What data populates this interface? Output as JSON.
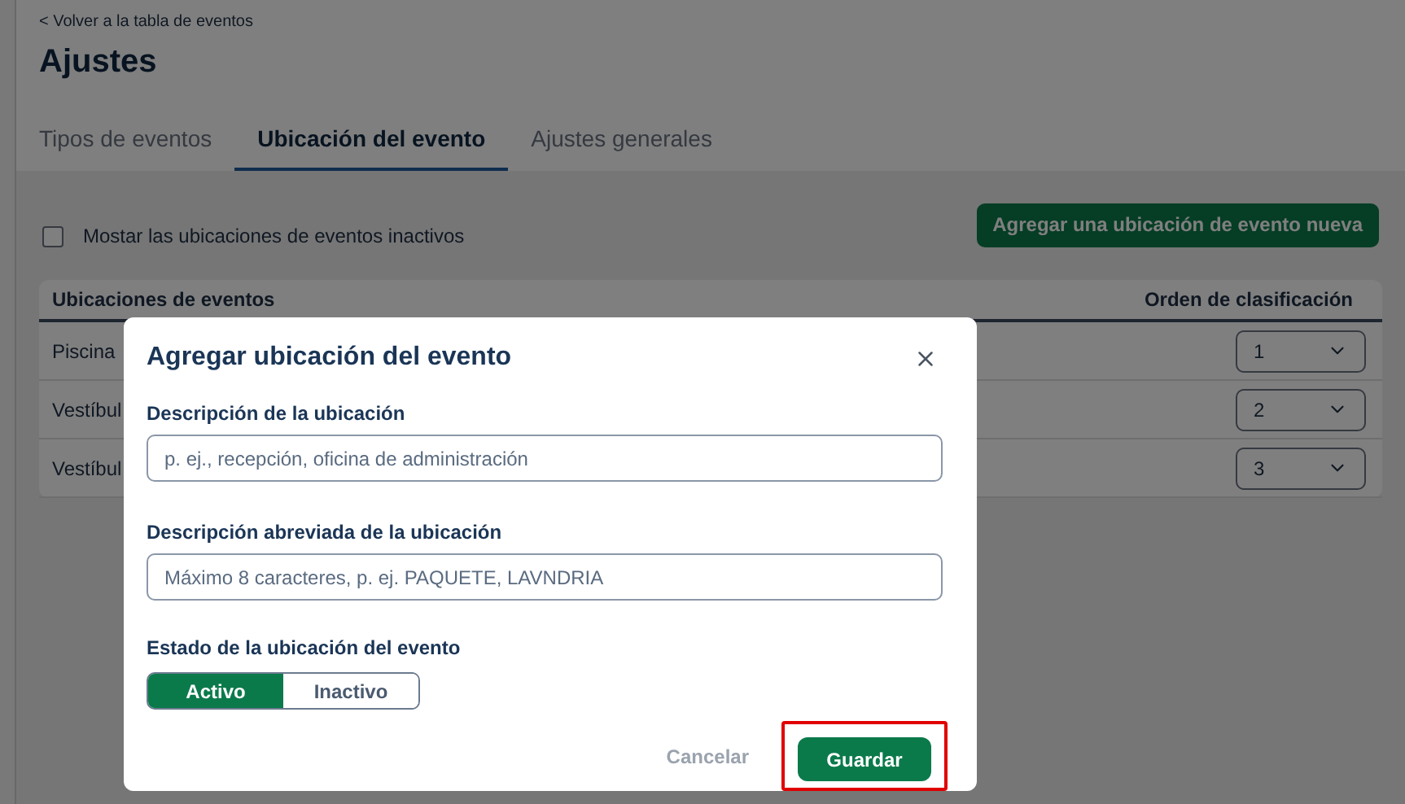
{
  "back_link": "< Volver a la tabla de eventos",
  "title": "Ajustes",
  "tabs": [
    {
      "label": "Tipos de eventos",
      "selected": false
    },
    {
      "label": "Ubicación del evento",
      "selected": true
    },
    {
      "label": "Ajustes generales",
      "selected": false
    }
  ],
  "show_inactive": {
    "label": "Mostar las ubicaciones de eventos inactivos",
    "checked": false
  },
  "add_button": "Agregar una ubicación de evento nueva",
  "table": {
    "columns": [
      "Ubicaciones de eventos",
      "Orden de clasificación"
    ],
    "rows": [
      {
        "name": "Piscina",
        "order": "1"
      },
      {
        "name": "Vestíbul",
        "order": "2"
      },
      {
        "name": "Vestíbul",
        "order": "3"
      }
    ]
  },
  "dialog": {
    "title": "Agregar ubicación del evento",
    "fields": [
      {
        "label": "Descripción de la ubicación",
        "placeholder": "p. ej., recepción, oficina de administración"
      },
      {
        "label": "Descripción abreviada de la ubicación",
        "placeholder": "Máximo 8 caracteres, p. ej. PAQUETE, LAVNDRIA"
      }
    ],
    "status": {
      "label": "Estado de la ubicación del evento",
      "options": [
        {
          "label": "Activo",
          "selected": true
        },
        {
          "label": "Inactivo",
          "selected": false
        }
      ]
    },
    "cancel": "Cancelar",
    "save": {
      "label": "Guardar",
      "highlighted": true
    }
  }
}
